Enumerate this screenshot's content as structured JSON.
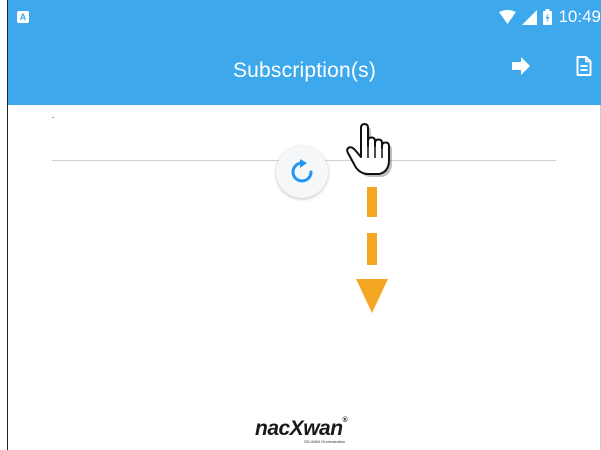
{
  "status_bar": {
    "app_icon_letter": "A",
    "time": "10:49"
  },
  "header": {
    "title": "Subscription(s)"
  },
  "icons": {
    "logout": "logout-icon",
    "document": "document-icon",
    "refresh": "refresh-icon",
    "pointer": "hand-pointer-icon",
    "arrow": "down-arrow-icon"
  },
  "colors": {
    "app_bar": "#3ea8ec",
    "refresh_icon": "#2196f3",
    "arrow": "#f5a623"
  },
  "footer": {
    "logo_main": "nacXwan",
    "logo_reg": "®",
    "logo_sub": "SD-WAN Orchestration"
  }
}
